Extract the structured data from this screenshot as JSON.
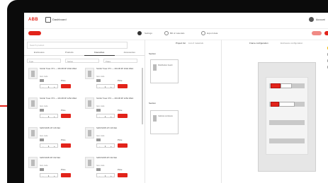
{
  "app": {
    "logo": "ABB",
    "dashboard_label": "Dashboard",
    "user_label": "Account"
  },
  "toolbar": {
    "left_pill": "New",
    "items": [
      "Settings",
      "Bill of materials",
      "Export data"
    ],
    "right_pill_1": "Save",
    "right_pill_2": "Send"
  },
  "catalog": {
    "search_placeholder": "Search product",
    "tabs": [
      "Enclosures",
      "Products",
      "Favourites",
      "Accessories"
    ],
    "filters": [
      "Type",
      "Series",
      "Poles"
    ],
    "products": [
      {
        "title": "SACE Tmax XT1 — MCCB 3P 160A 36kA",
        "meta": "Item code",
        "price": "Price",
        "qty": "1"
      },
      {
        "title": "SACE Tmax XT1 — MCCB 3P 160A 36kA",
        "meta": "Item code",
        "price": "Price",
        "qty": "1"
      },
      {
        "title": "SACE Tmax XT2 — MCCB 3P 125A 36kA",
        "meta": "Item code",
        "price": "Price",
        "qty": "1"
      },
      {
        "title": "SACE Tmax XT2 — MCCB 3P 125A 36kA",
        "meta": "Item code",
        "price": "Price",
        "qty": "1"
      },
      {
        "title": "S200 MCB 1P C16 6kA",
        "meta": "Item code",
        "price": "Price",
        "qty": "1"
      },
      {
        "title": "S200 MCB 1P C16 6kA",
        "meta": "Item code",
        "price": "Price",
        "qty": "1"
      },
      {
        "title": "S200 MCB 3P C32 6kA",
        "meta": "Item code",
        "price": "Price",
        "qty": "1"
      },
      {
        "title": "S200 MCB 3P C32 6kA",
        "meta": "Item code",
        "price": "Price",
        "qty": "1"
      }
    ]
  },
  "middle": {
    "tabs": [
      "Project list",
      "List of materials"
    ],
    "section1_title": "Section",
    "section2_title": "Section",
    "box1_text": "Distribution board",
    "box2_text": "Cabinet enclosure"
  },
  "configurator": {
    "tabs": [
      "Frame configuration",
      "Enclosure configuration"
    ]
  },
  "colors": {
    "accent": "#e2231a",
    "warning": "#f2b705"
  },
  "icons": [
    "home-icon",
    "user-icon",
    "gear-icon",
    "list-icon",
    "export-icon"
  ]
}
